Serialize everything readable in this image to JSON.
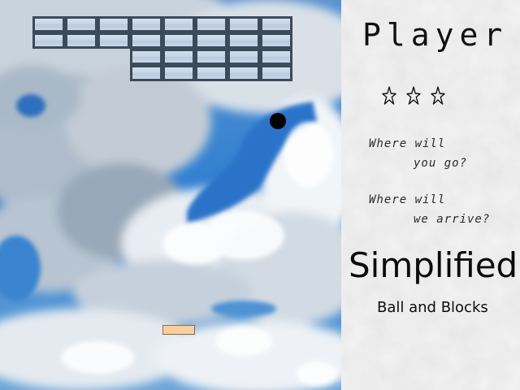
{
  "panel": {
    "player_label": "Player",
    "lives": 3,
    "life_icon": "star-outline-icon",
    "tagline": [
      {
        "line1": "Where will",
        "line2": "you go?"
      },
      {
        "line1": "Where will",
        "line2": "we arrive?"
      }
    ],
    "title": "Simplified",
    "subtitle": "Ball and Blocks"
  },
  "playfield": {
    "background": "sky-with-clouds",
    "blocks": [
      [
        1,
        1,
        1,
        1,
        1,
        1,
        1,
        1
      ],
      [
        1,
        1,
        1,
        1,
        1,
        1,
        1,
        1
      ],
      [
        0,
        0,
        0,
        1,
        1,
        1,
        1,
        1
      ],
      [
        0,
        0,
        0,
        1,
        1,
        1,
        1,
        1
      ]
    ],
    "ball_color": "#000000",
    "paddle_color": "#f8d0a0",
    "block_frame_color": "#3d4a5a"
  }
}
